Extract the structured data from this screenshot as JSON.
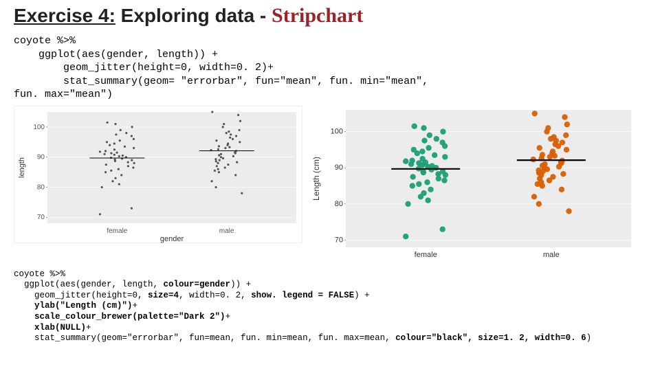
{
  "title": {
    "part1": "Exercise 4:",
    "part2": " Exploring data - ",
    "part3": "Stripchart"
  },
  "code_block_1": "coyote %>%\n    ggplot(aes(gender, length)) +\n        geom_jitter(height=0, width=0. 2)+\n        stat_summary(geom= \"errorbar\", fun=\"mean\", fun. min=\"mean\",\nfun. max=\"mean\")",
  "code_block_2_pre": "coyote %>%\n  ggplot(aes(gender, length, ",
  "code_block_2_b1": "colour=gender",
  "code_block_2_a": ")) +\n    geom_jitter(height=0, ",
  "code_block_2_b2": "size=4",
  "code_block_2_b": ", width=0. 2, ",
  "code_block_2_b3": "show. legend = FALSE",
  "code_block_2_c": ") +\n    ",
  "code_block_2_b4": "ylab(\"Length (cm)\")",
  "code_block_2_d": "+\n    ",
  "code_block_2_b5": "scale_colour_brewer(palette=\"Dark 2\")",
  "code_block_2_e": "+\n    ",
  "code_block_2_b6": "xlab(NULL)",
  "code_block_2_f": "+\n    stat_summary(geom=\"errorbar\", fun=mean, fun. min=mean, fun. max=mean, ",
  "code_block_2_b7": "colour=\"black\", size=1. 2, width=0. 6",
  "code_block_2_g": ")",
  "chart_data": [
    {
      "type": "scatter",
      "title": "",
      "xlabel": "gender",
      "ylabel": "length",
      "categories": [
        "female",
        "male"
      ],
      "y_ticks": [
        70,
        80,
        90,
        100
      ],
      "ylim": [
        68,
        105
      ],
      "mean": {
        "female": 89.7,
        "male": 92.1
      },
      "series": [
        {
          "name": "female",
          "values": [
            71,
            73,
            80,
            81,
            82,
            83,
            84,
            85,
            85.5,
            86,
            86.5,
            87,
            87.5,
            88,
            88.3,
            88.7,
            89,
            89.2,
            89.5,
            89.8,
            90,
            90.3,
            90.5,
            90.8,
            91,
            91.3,
            91.5,
            91.8,
            92,
            92.5,
            93,
            93.5,
            94,
            94.5,
            95,
            95.5,
            96,
            97,
            97.5,
            98,
            99,
            100,
            101,
            101.5
          ]
        },
        {
          "name": "male",
          "values": [
            78,
            80,
            82,
            84,
            85,
            85.5,
            86,
            86.5,
            87,
            87.5,
            88,
            88.3,
            88.6,
            89,
            89.3,
            89.6,
            90,
            90.3,
            90.6,
            91,
            91.3,
            91.6,
            92,
            92.3,
            92.6,
            93,
            93.3,
            93.6,
            94,
            94.5,
            95,
            95.5,
            96,
            96.5,
            97,
            97.5,
            98,
            98.5,
            99,
            100,
            101,
            102,
            104,
            105
          ]
        }
      ]
    },
    {
      "type": "scatter",
      "title": "",
      "xlabel": "",
      "ylabel": "Length (cm)",
      "categories": [
        "female",
        "male"
      ],
      "y_ticks": [
        70,
        80,
        90,
        100
      ],
      "ylim": [
        68,
        106
      ],
      "mean": {
        "female": 89.7,
        "male": 92.1
      },
      "colors": {
        "female": "#1b9e77",
        "male": "#d95f02"
      },
      "series": [
        {
          "name": "female",
          "values": [
            71,
            73,
            80,
            81,
            82,
            83,
            84,
            85,
            85.5,
            86,
            86.5,
            87,
            87.5,
            88,
            88.3,
            88.7,
            89,
            89.2,
            89.5,
            89.8,
            90,
            90.3,
            90.5,
            90.8,
            91,
            91.3,
            91.5,
            91.8,
            92,
            92.5,
            93,
            93.5,
            94,
            94.5,
            95,
            95.5,
            96,
            97,
            97.5,
            98,
            99,
            100,
            101,
            101.5
          ]
        },
        {
          "name": "male",
          "values": [
            78,
            80,
            82,
            84,
            85,
            85.5,
            86,
            86.5,
            87,
            87.5,
            88,
            88.3,
            88.6,
            89,
            89.3,
            89.6,
            90,
            90.3,
            90.6,
            91,
            91.3,
            91.6,
            92,
            92.3,
            92.6,
            93,
            93.3,
            93.6,
            94,
            94.5,
            95,
            95.5,
            96,
            96.5,
            97,
            97.5,
            98,
            98.5,
            99,
            100,
            101,
            102,
            104,
            105
          ]
        }
      ]
    }
  ]
}
